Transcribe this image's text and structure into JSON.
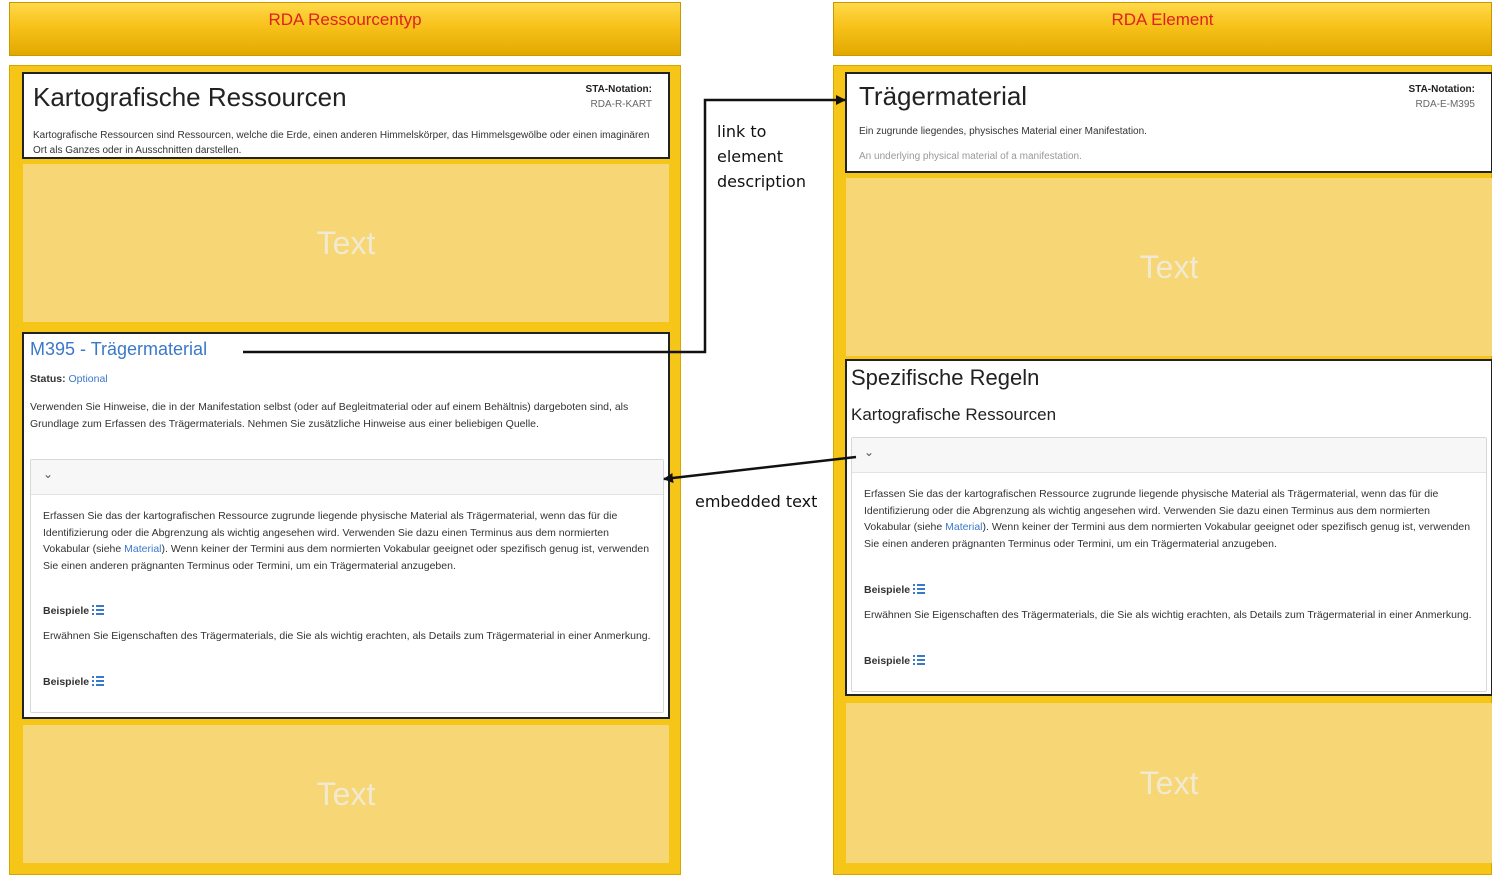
{
  "left": {
    "header": "RDA Ressourcentyp",
    "top_card": {
      "title": "Kartografische Ressourcen",
      "sta_label": "STA-Notation:",
      "sta_value": "RDA-R-KART",
      "description": "Kartografische Ressourcen sind Ressourcen, welche die Erde, einen anderen Himmelskörper, das Himmelsgewölbe oder einen imaginären Ort als Ganzes oder in Ausschnitten darstellen."
    },
    "placeholder_top": "Text",
    "element_card": {
      "link_title": "M395 - Trägermaterial",
      "status_label": "Status:",
      "status_value": "Optional",
      "intro": "Verwenden Sie Hinweise, die in der Manifestation selbst (oder auf Begleitmaterial oder auf einem Behältnis) dargeboten sind, als Grundlage zum Erfassen des Trägermaterials. Nehmen Sie zusätzliche Hinweise aus einer beliebigen Quelle.",
      "chevron": "⌄",
      "rule1_before": "Erfassen Sie das der kartografischen Ressource zugrunde liegende physische Material als Trägermaterial, wenn das für die Identifizierung oder die Abgrenzung als wichtig angesehen wird. Verwenden Sie dazu einen Terminus aus dem normierten Vokabular (siehe ",
      "rule1_link": "Material",
      "rule1_after": "). Wenn keiner der Termini aus dem normierten Vokabular geeignet oder spezifisch genug ist, verwenden Sie einen anderen prägnanten Terminus oder Termini, um ein Trägermaterial anzugeben.",
      "examples1": "Beispiele",
      "rule2": "Erwähnen Sie Eigenschaften des Trägermaterials, die Sie als wichtig erachten, als Details zum Trägermaterial in einer Anmerkung.",
      "examples2": "Beispiele"
    },
    "placeholder_bottom": "Text"
  },
  "right": {
    "header": "RDA Element",
    "top_card": {
      "title": "Trägermaterial",
      "sta_label": "STA-Notation:",
      "sta_value": "RDA-E-M395",
      "description_de": "Ein zugrunde liegendes, physisches Material einer Manifestation.",
      "description_en": "An underlying physical material of a manifestation."
    },
    "placeholder_top": "Text",
    "rules_card": {
      "heading": "Spezifische Regeln",
      "subheading": "Kartografische Ressourcen",
      "chevron": "⌄",
      "rule1_before": "Erfassen Sie das der kartografischen Ressource zugrunde liegende physische Material als Trägermaterial, wenn das für die Identifizierung oder die Abgrenzung als wichtig angesehen wird. Verwenden Sie dazu einen Terminus aus dem normierten Vokabular (siehe ",
      "rule1_link": "Material",
      "rule1_after": "). Wenn keiner der Termini aus dem normierten Vokabular geeignet oder spezifisch genug ist, verwenden Sie einen anderen prägnanten Terminus oder Termini, um ein Trägermaterial anzugeben.",
      "examples1": "Beispiele",
      "rule2": "Erwähnen Sie Eigenschaften des Trägermaterials, die Sie als wichtig erachten, als Details zum Trägermaterial in einer Anmerkung.",
      "examples2": "Beispiele"
    },
    "placeholder_bottom": "Text"
  },
  "annotations": {
    "link_line1": "link to",
    "link_line2": "element",
    "link_line3": "description",
    "embedded": "embedded text"
  },
  "colors": {
    "header_text": "#e02020",
    "panel": "#f5c518",
    "placeholder": "#f6d675",
    "link": "#3a78c9"
  }
}
